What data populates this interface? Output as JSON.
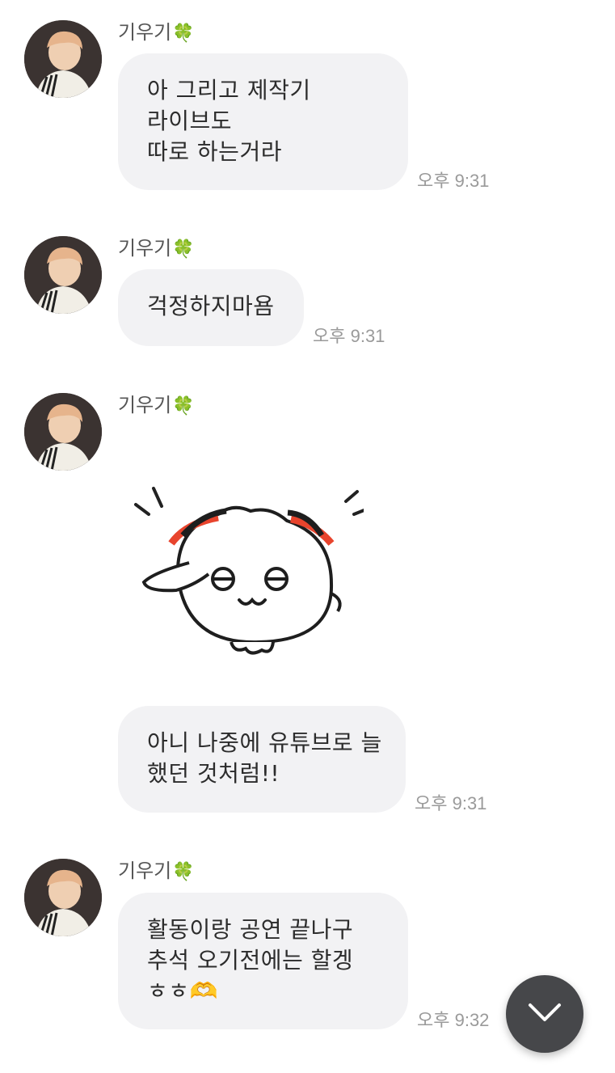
{
  "messages": [
    {
      "sender": "기우기",
      "sender_emoji": "🍀",
      "lines": [
        "아 그리고 제작기",
        "라이브도",
        "따로 하는거라"
      ],
      "time": "오후 9:31"
    },
    {
      "sender": "기우기",
      "sender_emoji": "🍀",
      "lines": [
        "걱정하지마욤"
      ],
      "time": "오후 9:31"
    },
    {
      "sender": "기우기",
      "sender_emoji": "🍀",
      "sticker": "saluting-dumpling-sticker"
    },
    {
      "lines": [
        "아니 나중에 유튜브로 늘",
        "했던 것처럼!!"
      ],
      "time": "오후 9:31"
    },
    {
      "sender": "기우기",
      "sender_emoji": "🍀",
      "lines": [
        "활동이랑 공연 끝나구",
        "추석 오기전에는 할겡",
        "ㅎㅎ🫶"
      ],
      "time": "오후 9:32"
    }
  ],
  "scroll_button": {
    "icon": "chevron-down-icon"
  },
  "colors": {
    "bubble": "#f2f2f4",
    "fab": "#46474a",
    "time": "#9a9a9a"
  }
}
